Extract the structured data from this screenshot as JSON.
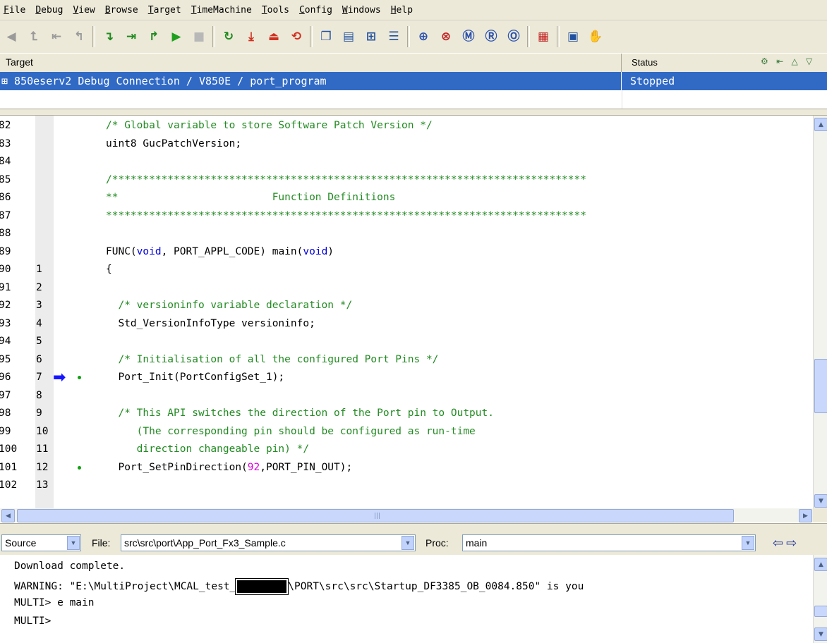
{
  "menu": [
    "File",
    "Debug",
    "View",
    "Browse",
    "Target",
    "TimeMachine",
    "Tools",
    "Config",
    "Windows",
    "Help"
  ],
  "toolbar_groups": [
    [
      {
        "icon": "step-back-icon",
        "glyph": "◀",
        "color": "#9a9a9a"
      },
      {
        "icon": "back-step-up-icon",
        "glyph": "⮤",
        "color": "#9a9a9a"
      },
      {
        "icon": "back-to-start-icon",
        "glyph": "⇤",
        "color": "#9a9a9a"
      },
      {
        "icon": "back-step-out-icon",
        "glyph": "↰",
        "color": "#9a9a9a"
      }
    ],
    [
      {
        "icon": "step-into-icon",
        "glyph": "↴",
        "color": "#1f8a1f"
      },
      {
        "icon": "step-over-icon",
        "glyph": "⇥",
        "color": "#1f8a1f"
      },
      {
        "icon": "step-out-icon",
        "glyph": "↱",
        "color": "#1f8a1f"
      },
      {
        "icon": "run-icon",
        "glyph": "▶",
        "color": "#1ea01e"
      },
      {
        "icon": "halt-icon",
        "glyph": "■",
        "color": "#b8b8b8"
      }
    ],
    [
      {
        "icon": "restart-icon",
        "glyph": "↻",
        "color": "#1f8a1f"
      },
      {
        "icon": "download-icon",
        "glyph": "⤓",
        "color": "#d03020"
      },
      {
        "icon": "flash-icon",
        "glyph": "⏏",
        "color": "#d03020"
      },
      {
        "icon": "reload-icon",
        "glyph": "⟲",
        "color": "#d03020"
      }
    ],
    [
      {
        "icon": "copy-icon",
        "glyph": "❐",
        "color": "#2050a0"
      },
      {
        "icon": "document-icon",
        "glyph": "▤",
        "color": "#2050a0"
      },
      {
        "icon": "tree-icon",
        "glyph": "⊞",
        "color": "#2050a0"
      },
      {
        "icon": "outline-icon",
        "glyph": "☰",
        "color": "#2050a0"
      }
    ],
    [
      {
        "icon": "magnifier-icon",
        "glyph": "⊕",
        "color": "#2a50b0"
      },
      {
        "icon": "stop-inspect-icon",
        "glyph": "⊗",
        "color": "#c02020"
      },
      {
        "icon": "memory-view-icon",
        "glyph": "Ⓜ",
        "color": "#2a50b0"
      },
      {
        "icon": "register-view-icon",
        "glyph": "Ⓡ",
        "color": "#2a50b0"
      },
      {
        "icon": "watch-view-icon",
        "glyph": "Ⓞ",
        "color": "#2a50b0"
      }
    ],
    [
      {
        "icon": "grid-icon",
        "glyph": "▦",
        "color": "#c02020"
      }
    ],
    [
      {
        "icon": "notes-icon",
        "glyph": "▣",
        "color": "#2050a0"
      },
      {
        "icon": "hand-icon",
        "glyph": "✋",
        "color": "#9a9a9a"
      }
    ]
  ],
  "target_pane": {
    "header_target": "Target",
    "header_status": "Status",
    "header_icons": "⚙ ⇤ △ ▽",
    "row_name": "⊞ 850eserv2 Debug Connection / V850E / port_program",
    "row_status": "Stopped"
  },
  "source": {
    "lines": [
      {
        "ln": "82",
        "fn": "",
        "marker": "",
        "parts": [
          {
            "t": "/* Global variable to store Software Patch Version */",
            "c": "com"
          }
        ]
      },
      {
        "ln": "83",
        "fn": "",
        "marker": "",
        "parts": [
          {
            "t": "uint8 GucPatchVersion;",
            "c": ""
          }
        ]
      },
      {
        "ln": "84",
        "fn": "",
        "marker": "",
        "parts": []
      },
      {
        "ln": "85",
        "fn": "",
        "marker": "",
        "parts": [
          {
            "t": "/*****************************************************************************",
            "c": "com"
          }
        ]
      },
      {
        "ln": "86",
        "fn": "",
        "marker": "",
        "parts": [
          {
            "t": "**                         Function Definitions",
            "c": "com"
          }
        ]
      },
      {
        "ln": "87",
        "fn": "",
        "marker": "",
        "parts": [
          {
            "t": "******************************************************************************",
            "c": "com"
          }
        ]
      },
      {
        "ln": "88",
        "fn": "",
        "marker": "",
        "parts": []
      },
      {
        "ln": "89",
        "fn": "",
        "marker": "",
        "parts": [
          {
            "t": "FUNC(",
            "c": ""
          },
          {
            "t": "void",
            "c": "kw"
          },
          {
            "t": ", PORT_APPL_CODE) main(",
            "c": ""
          },
          {
            "t": "void",
            "c": "kw"
          },
          {
            "t": ")",
            "c": ""
          }
        ]
      },
      {
        "ln": "90",
        "fn": "1",
        "marker": "",
        "parts": [
          {
            "t": "{",
            "c": ""
          }
        ]
      },
      {
        "ln": "91",
        "fn": "2",
        "marker": "",
        "parts": []
      },
      {
        "ln": "92",
        "fn": "3",
        "marker": "",
        "parts": [
          {
            "t": "  /* versioninfo variable declaration */",
            "c": "com"
          }
        ]
      },
      {
        "ln": "93",
        "fn": "4",
        "marker": "",
        "parts": [
          {
            "t": "  Std_VersionInfoType versioninfo;",
            "c": ""
          }
        ]
      },
      {
        "ln": "94",
        "fn": "5",
        "marker": "",
        "parts": []
      },
      {
        "ln": "95",
        "fn": "6",
        "marker": "",
        "parts": [
          {
            "t": "  /* Initialisation of all the configured Port Pins */",
            "c": "com"
          }
        ]
      },
      {
        "ln": "96",
        "fn": "7",
        "marker": "arrow",
        "parts": [
          {
            "t": "  Port_Init(PortConfigSet_1);",
            "c": ""
          }
        ]
      },
      {
        "ln": "97",
        "fn": "8",
        "marker": "",
        "parts": []
      },
      {
        "ln": "98",
        "fn": "9",
        "marker": "",
        "parts": [
          {
            "t": "  /* This API switches the direction of the Port pin to Output.",
            "c": "com"
          }
        ]
      },
      {
        "ln": "99",
        "fn": "10",
        "marker": "",
        "parts": [
          {
            "t": "     (The corresponding pin should be configured as run-time",
            "c": "com"
          }
        ]
      },
      {
        "ln": "100",
        "fn": "11",
        "marker": "",
        "parts": [
          {
            "t": "     direction changeable pin) */",
            "c": "com"
          }
        ]
      },
      {
        "ln": "101",
        "fn": "12",
        "marker": "dot",
        "parts": [
          {
            "t": "  Port_SetPinDirection(",
            "c": ""
          },
          {
            "t": "92",
            "c": "num"
          },
          {
            "t": ",PORT_PIN_OUT);",
            "c": ""
          }
        ]
      },
      {
        "ln": "102",
        "fn": "13",
        "marker": "",
        "parts": []
      }
    ]
  },
  "nav": {
    "view_mode": "Source",
    "file_label": "File:",
    "file_value": "src\\src\\port\\App_Port_Fx3_Sample.c",
    "proc_label": "Proc:",
    "proc_value": "main"
  },
  "console": {
    "line1": "Download complete.",
    "warning_prefix": "WARNING: \"E:\\MultiProject\\MCAL_test_",
    "warning_suffix": "\\PORT\\src\\src\\Startup_DF3385_OB_0084.850\" is you",
    "line3": "MULTI> e main",
    "line4": "MULTI>"
  }
}
